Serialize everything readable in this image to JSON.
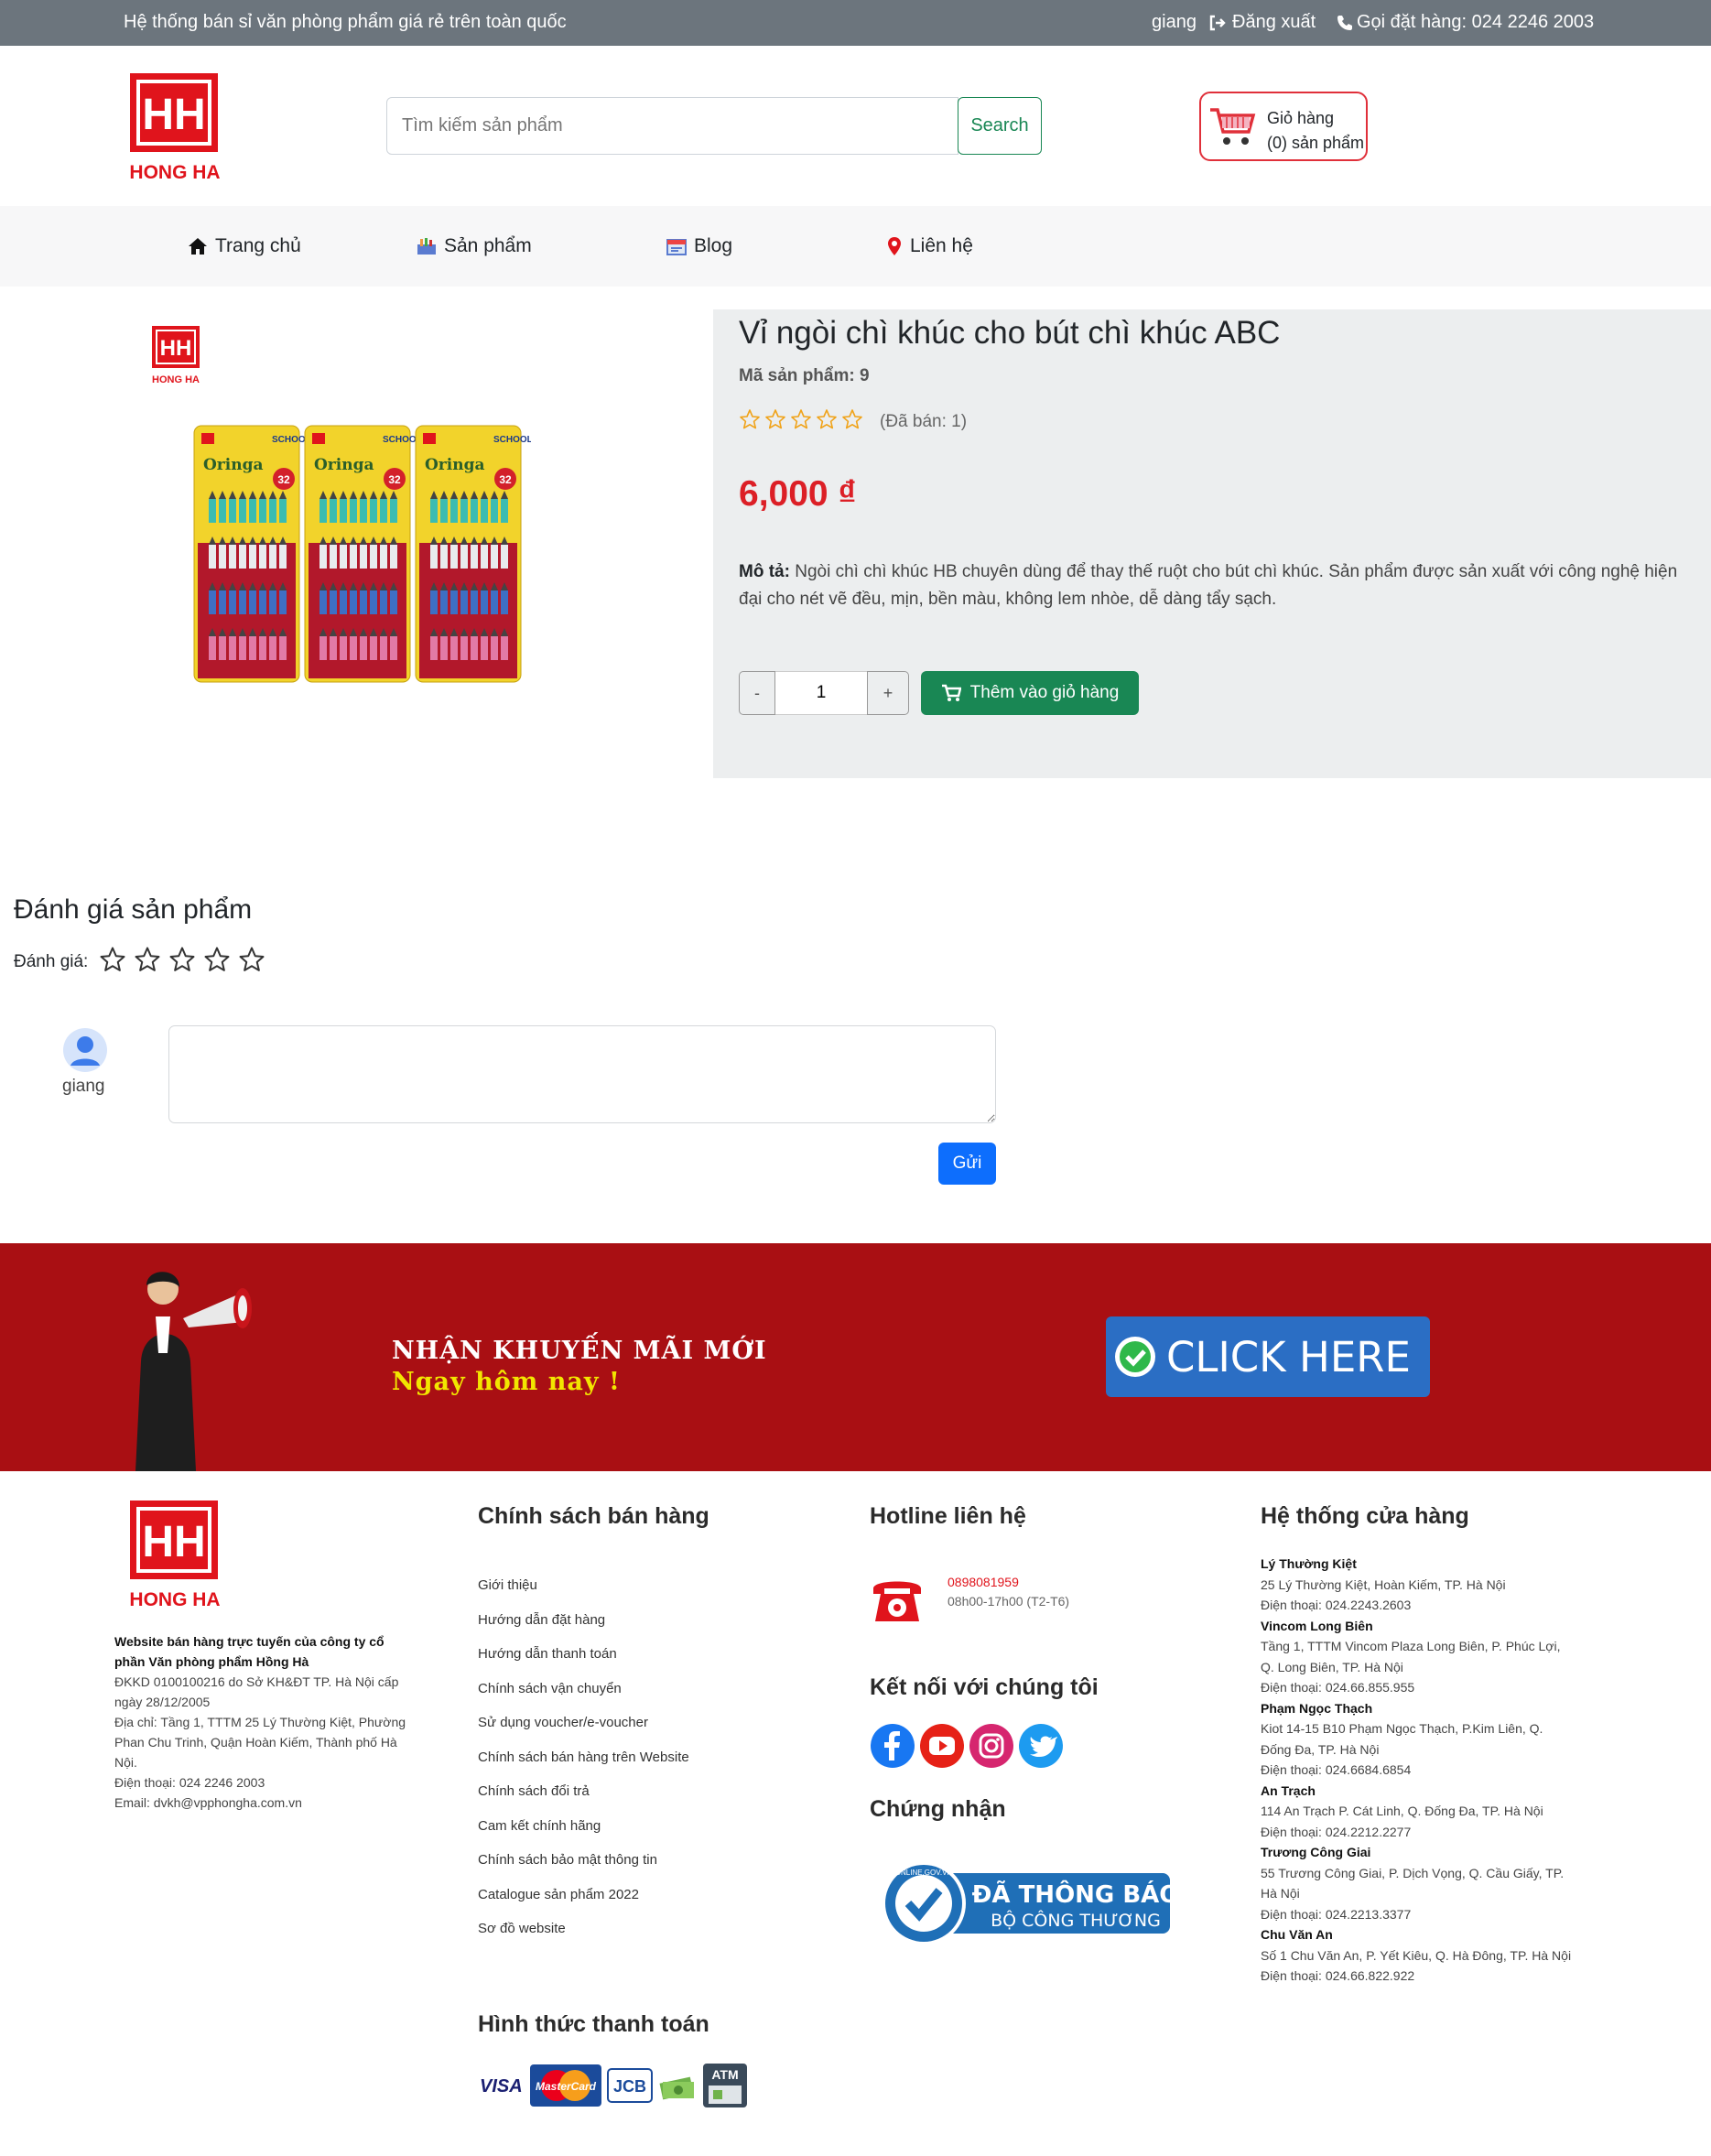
{
  "topbar": {
    "tagline": "Hệ thống bán sỉ văn phòng phẩm giá rẻ trên toàn quốc",
    "user": "giang",
    "logout": "Đăng xuất",
    "hotline": "Gọi đặt hàng: 024 2246 2003"
  },
  "brand": {
    "name": "HONG HA",
    "mark": "HH",
    "color": "#e0141c"
  },
  "search": {
    "placeholder": "Tìm kiếm sản phẩm",
    "button": "Search"
  },
  "cart": {
    "title": "Giỏ hàng",
    "count": "(0) sản phẩm"
  },
  "nav": [
    {
      "label": "Trang chủ",
      "icon": "home-icon"
    },
    {
      "label": "Sản phẩm",
      "icon": "products-icon"
    },
    {
      "label": "Blog",
      "icon": "blog-icon"
    },
    {
      "label": "Liên hệ",
      "icon": "location-pin-icon"
    }
  ],
  "product": {
    "title": "Vỉ ngòi chì khúc cho bút chì khúc ABC",
    "code": "Mã sản phẩm: 9",
    "sold": "(Đã bán: 1)",
    "rating": 0,
    "price": "6,000 ₫",
    "desc_label": "Mô tả:",
    "desc": "Ngòi chì chì khúc HB chuyên dùng để thay thế ruột cho bút chì khúc. Sản phẩm được sản xuất với công nghệ hiện đại cho nét vẽ đều, mịn, bền màu, không lem nhòe, dễ dàng tẩy sạch.",
    "qty": "1",
    "minus": "-",
    "plus": "+",
    "add_to_cart": "Thêm vào giỏ hàng",
    "package_brand": "SCHOOL",
    "package_name": "Oringa",
    "package_count": "32"
  },
  "review": {
    "heading": "Đánh giá sản phẩm",
    "rating_label": "Đánh giá:",
    "user": "giang",
    "submit": "Gửi"
  },
  "banner": {
    "line1": "NHẬN KHUYẾN MÃI MỚI",
    "line2": "Ngay hôm nay !",
    "cta": "CLICK HERE"
  },
  "footer": {
    "company": {
      "title": "Website bán hàng trực tuyến của công ty cổ phần Văn phòng phẩm Hồng Hà",
      "lines": [
        "ĐKKD 0100100216 do Sở KH&ĐT TP. Hà Nội cấp ngày 28/12/2005",
        "Địa chỉ: Tầng 1, TTTM 25 Lý Thường Kiệt, Phường Phan Chu Trinh, Quận Hoàn Kiếm, Thành phố Hà Nội.",
        "Điện thoại: 024 2246 2003",
        "Email: dvkh@vpphongha.com.vn"
      ]
    },
    "policy_heading": "Chính sách bán hàng",
    "policies": [
      "Giới thiệu",
      "Hướng dẫn đặt hàng",
      "Hướng dẫn thanh toán",
      "Chính sách vận chuyển",
      "Sử dụng voucher/e-voucher",
      "Chính sách bán hàng trên Website",
      "Chính sách đổi trả",
      "Cam kết chính hãng",
      "Chính sách bảo mật thông tin",
      "Catalogue sản phẩm 2022",
      "Sơ đồ website"
    ],
    "payment_heading": "Hình thức thanh toán",
    "payments": [
      "VISA",
      "MasterCard",
      "JCB",
      "ATM"
    ],
    "hotline_heading": "Hotline liên hệ",
    "hotline_number": "0898081959",
    "hotline_hours": "08h00-17h00 (T2-T6)",
    "social_heading": "Kết nối với chúng tôi",
    "cert_heading": "Chứng nhận",
    "cert_big": "ĐÃ THÔNG BÁO",
    "cert_small": "BỘ CÔNG THƯƠNG",
    "cert_ring": "ONLINE.GOV.VN",
    "stores_heading": "Hệ thống cửa hàng",
    "stores": [
      {
        "name": "Lý Thường Kiệt",
        "addr": "25 Lý Thường Kiệt, Hoàn Kiếm, TP. Hà Nội",
        "phone": "Điện thoại: 024.2243.2603"
      },
      {
        "name": "Vincom Long Biên",
        "addr": "Tầng 1, TTTM Vincom Plaza Long Biên, P. Phúc Lợi, Q. Long Biên, TP. Hà Nội",
        "phone": "Điện thoại: 024.66.855.955"
      },
      {
        "name": "Phạm Ngọc Thạch",
        "addr": "Kiot 14-15 B10 Phạm Ngọc Thạch, P.Kim Liên, Q. Đống Đa, TP. Hà Nội",
        "phone": "Điện thoại: 024.6684.6854"
      },
      {
        "name": "An Trạch",
        "addr": "114 An Trạch P. Cát Linh, Q. Đống Đa, TP. Hà Nội",
        "phone": "Điện thoại: 024.2212.2277"
      },
      {
        "name": "Trương Công Giai",
        "addr": "55 Trương Công Giai, P. Dịch Vọng, Q. Cầu Giấy, TP. Hà Nội",
        "phone": "Điện thoại: 024.2213.3377"
      },
      {
        "name": "Chu Văn An",
        "addr": "Số 1 Chu Văn An, P. Yết Kiêu, Q. Hà Đông, TP. Hà Nội",
        "phone": "Điện thoại: 024.66.822.922"
      }
    ]
  }
}
